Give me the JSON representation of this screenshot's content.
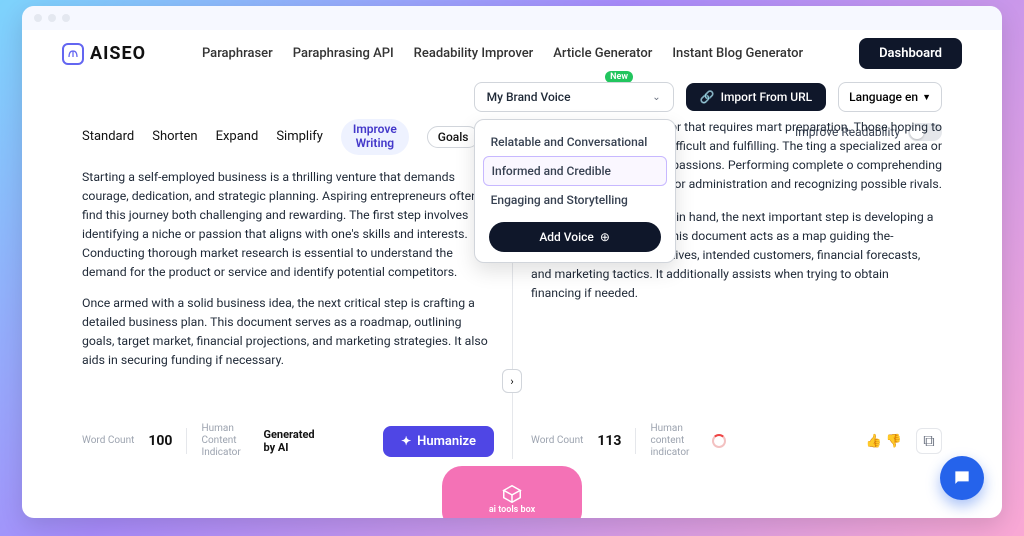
{
  "logo_text": "AISEO",
  "nav": {
    "paraphraser": "Paraphraser",
    "api": "Paraphrasing API",
    "readability": "Readability Improver",
    "article": "Article Generator",
    "blog": "Instant Blog Generator"
  },
  "dashboard": "Dashboard",
  "new_badge": "New",
  "brand_voice": {
    "label": "My Brand Voice",
    "options": {
      "relatable": "Relatable and Conversational",
      "informed": "Informed and Credible",
      "engaging": "Engaging and Storytelling"
    },
    "add": "Add Voice"
  },
  "import_url": "Import From URL",
  "language": "Language  en",
  "improve_readability": "Improve Readability",
  "tabs": {
    "standard": "Standard",
    "shorten": "Shorten",
    "expand": "Expand",
    "simplify": "Simplify",
    "improve": "Improve Writing",
    "goals": "Goals"
  },
  "left": {
    "p1": "Starting a self-employed business is a thrilling venture that demands courage, dedication, and strategic planning. Aspiring entrepreneurs often find this journey both challenging and rewarding. The first step involves identifying a niche or passion that aligns with one's skills and interests. Conducting thorough market research is essential to understand the demand for the product or service and identify potential competitors.",
    "p2": "Once armed with a solid business idea, the next critical step is crafting a detailed business plan. This document serves as a roadmap, outlining goals, target market, financial projections, and marketing strategies. It also aids in securing funding if necessary.",
    "word_count_label": "Word Count",
    "word_count": "100",
    "hci_label": "Human Content Indicator",
    "generated": "Generated by AI",
    "humanize": "Humanize"
  },
  "right": {
    "p1": "y is an exciting endeavor that requires mart preparation. Those hoping to be their er this trip both difficult and fulfilling. The ting a specialized area or enthusiasm that es and passions. Performing complete o comprehending the need for the item or administration and recognizing possible rivals.",
    "p2": "With a solid business idea in hand, the next important step is developing a thorough business plan. This document acts as a map guiding the-business, laying out objectives, intended customers, financial forecasts, and marketing tactics. It additionally assists when trying to obtain financing if needed.",
    "word_count_label": "Word Count",
    "word_count": "113",
    "hci_label": "Human content indicator"
  },
  "watermark": "ai tools box"
}
